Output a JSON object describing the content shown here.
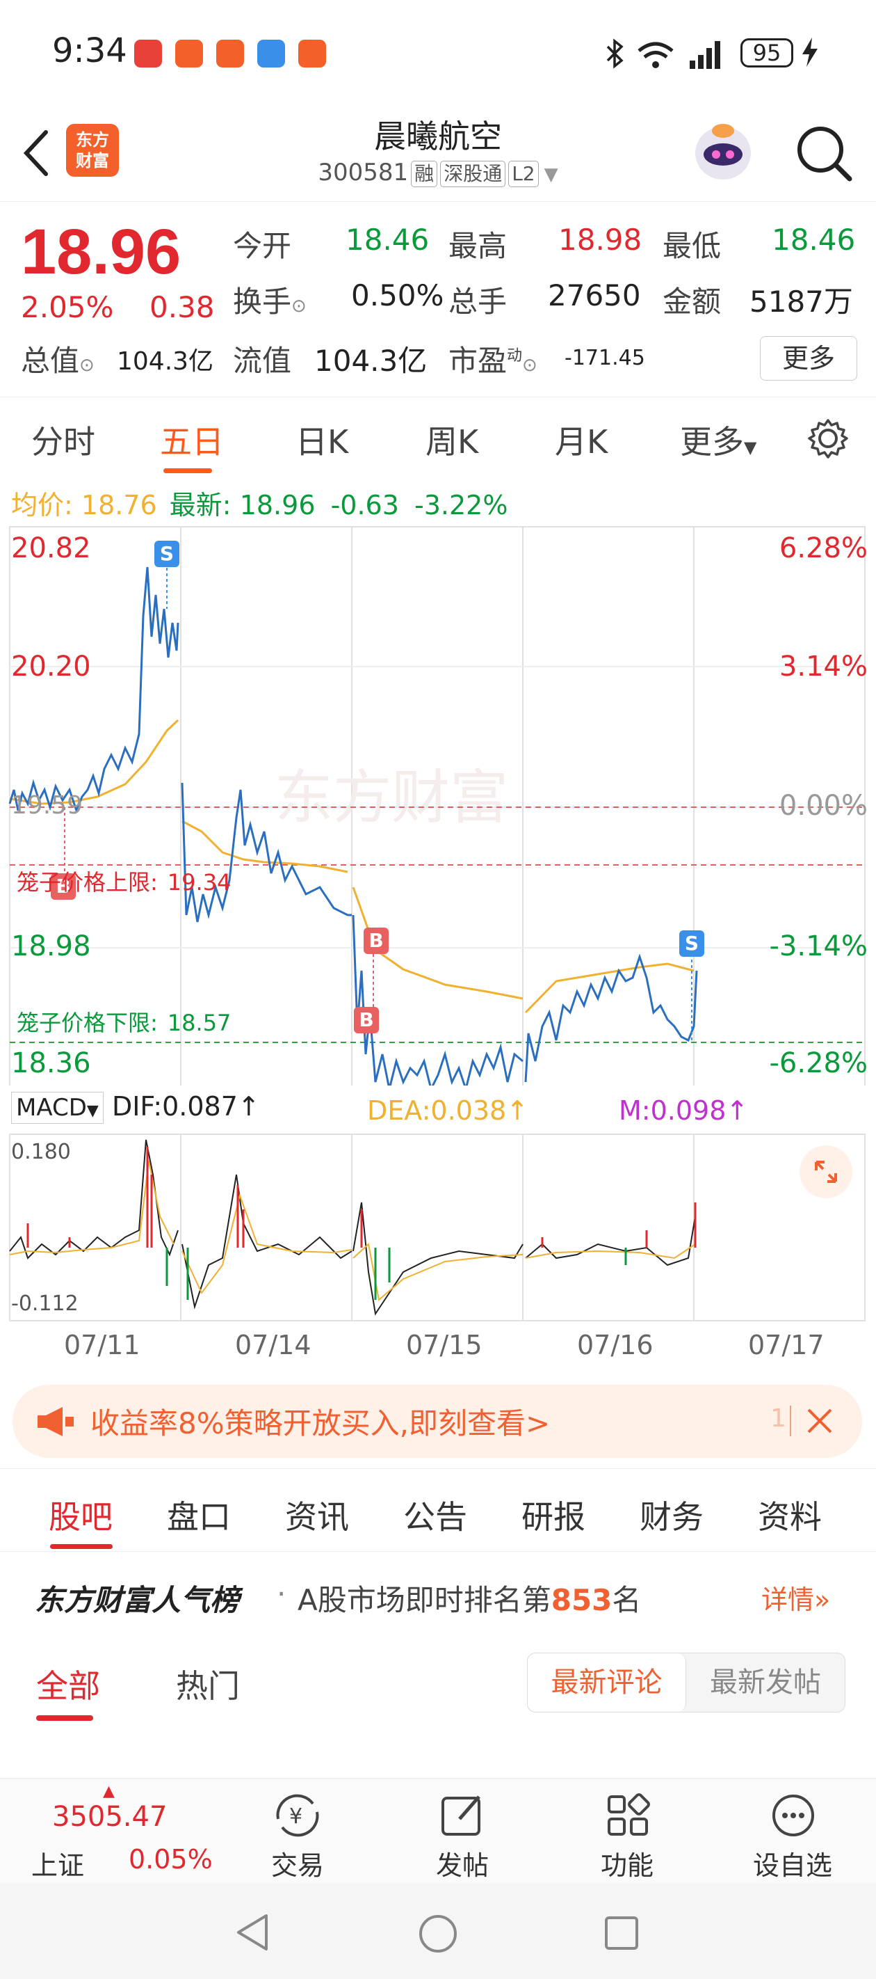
{
  "status_bar": {
    "time": "9:34",
    "battery": "95"
  },
  "header": {
    "logo_text": "东方财富",
    "title": "晨曦航空",
    "code": "300581",
    "tags": [
      "融",
      "深股通",
      "L2"
    ]
  },
  "quote": {
    "price": "18.96",
    "change_pct": "2.05%",
    "change": "0.38",
    "open_label": "今开",
    "open": "18.46",
    "high_label": "最高",
    "high": "18.98",
    "low_label": "最低",
    "low": "18.46",
    "turnover_label": "换手",
    "turnover": "0.50%",
    "volume_label": "总手",
    "volume": "27650",
    "amount_label": "金额",
    "amount": "5187万",
    "mktcap_label": "总值",
    "mktcap": "104.3亿",
    "float_label": "流值",
    "float_cap": "104.3亿",
    "pe_label": "市盈",
    "pe_sup": "动",
    "pe": "-171.45",
    "more_label": "更多"
  },
  "period_tabs": [
    {
      "label": "分时"
    },
    {
      "label": "五日"
    },
    {
      "label": "日K"
    },
    {
      "label": "周K"
    },
    {
      "label": "月K"
    },
    {
      "label": "更多"
    }
  ],
  "avg_line": {
    "avg_label": "均价:",
    "avg": "18.76",
    "latest_label": "最新:",
    "latest": "18.96",
    "chg": "-0.63",
    "chg_pct": "-3.22%"
  },
  "chart_labels": {
    "y_left": [
      "20.82",
      "20.20",
      "18.98",
      "18.36"
    ],
    "y_right": [
      "6.28%",
      "3.14%",
      "0.00%",
      "-3.14%",
      "-6.28%"
    ],
    "prev_close_label": "19.59",
    "upper_limit_label": "笼子价格上限:",
    "upper_limit": "19.34",
    "lower_limit_label": "笼子价格下限:",
    "lower_limit": "18.57",
    "watermark": "东方财富",
    "markers": [
      "S",
      "B",
      "B",
      "B",
      "S"
    ]
  },
  "macd": {
    "name": "MACD",
    "dif": "DIF:0.087↑",
    "dea": "DEA:0.038↑",
    "m": "M:0.098↑",
    "ymax": "0.180",
    "ymin": "-0.112"
  },
  "dates": [
    "07/11",
    "07/14",
    "07/15",
    "07/16",
    "07/17"
  ],
  "chart_data": {
    "type": "line",
    "x": [
      "07/11",
      "07/14",
      "07/15",
      "07/16",
      "07/17"
    ],
    "ylim": [
      18.36,
      20.82
    ],
    "series": [],
    "prev_close": 19.59
  },
  "banner": {
    "text": "收益率8%策略开放买入,即刻查看>",
    "counter": "1"
  },
  "sub_tabs": [
    {
      "label": "股吧"
    },
    {
      "label": "盘口"
    },
    {
      "label": "资讯"
    },
    {
      "label": "公告"
    },
    {
      "label": "研报"
    },
    {
      "label": "财务"
    },
    {
      "label": "资料"
    }
  ],
  "popularity": {
    "brand": "东方财富人气榜",
    "dot": "·",
    "prefix": "A股市场即时排名第",
    "rank": "853",
    "suffix": "名",
    "detail": "详情"
  },
  "filter": {
    "all": "全部",
    "hot": "热门",
    "newest_comment": "最新评论",
    "newest_post": "最新发帖"
  },
  "bottom_bar": {
    "index_value": "3505.47",
    "index_name": "上证",
    "index_pct": "0.05%",
    "items": [
      {
        "label": "交易"
      },
      {
        "label": "发帖"
      },
      {
        "label": "功能"
      },
      {
        "label": "设自选"
      }
    ]
  }
}
